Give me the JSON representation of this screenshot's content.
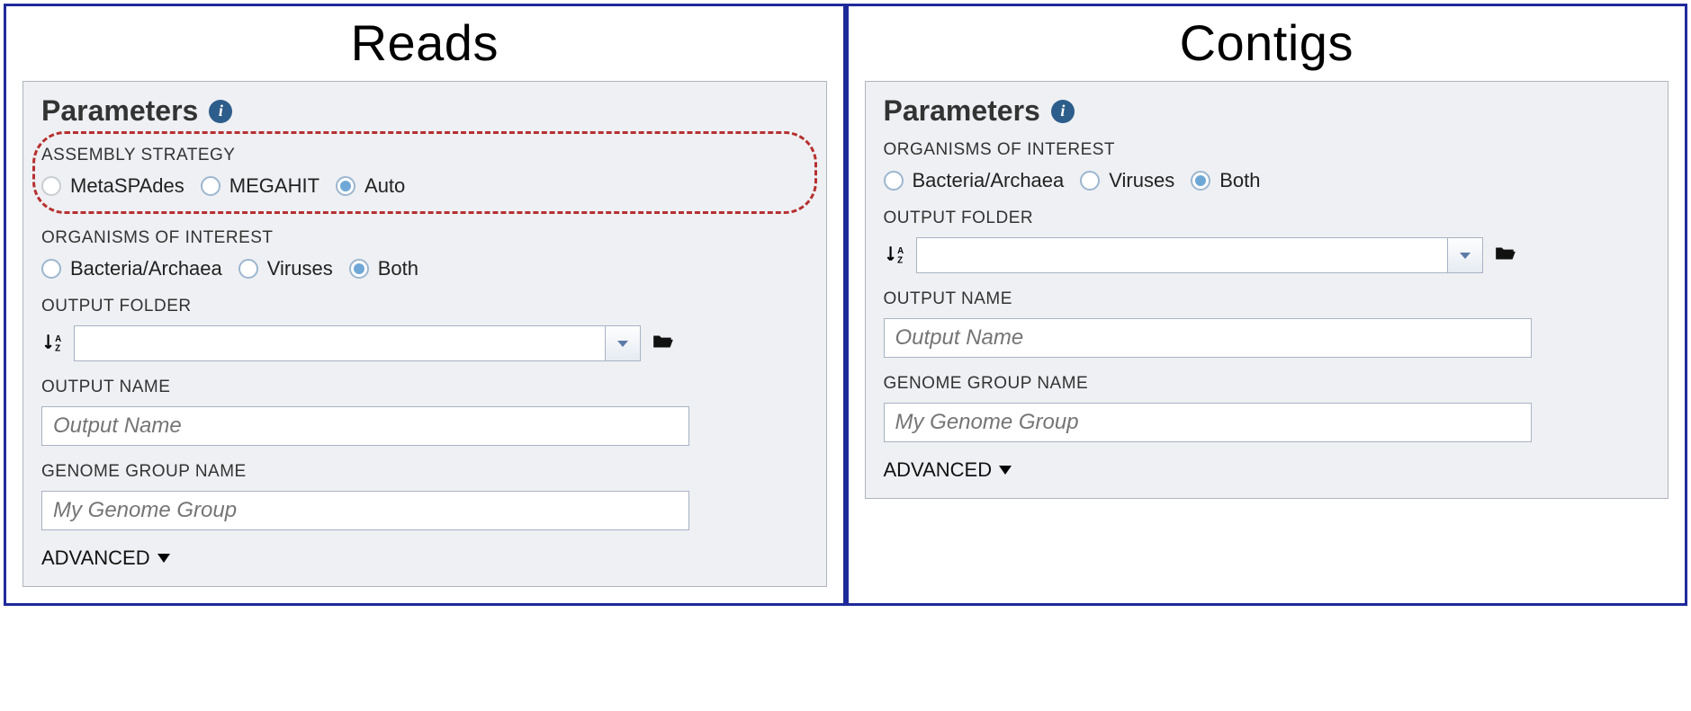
{
  "reads": {
    "title": "Reads",
    "params_heading": "Parameters",
    "assembly_strategy": {
      "label": "ASSEMBLY STRATEGY",
      "options": [
        "MetaSPAdes",
        "MEGAHIT",
        "Auto"
      ],
      "selected": "Auto"
    },
    "organisms": {
      "label": "ORGANISMS OF INTEREST",
      "options": [
        "Bacteria/Archaea",
        "Viruses",
        "Both"
      ],
      "selected": "Both"
    },
    "output_folder": {
      "label": "OUTPUT FOLDER",
      "value": ""
    },
    "output_name": {
      "label": "OUTPUT NAME",
      "value": "",
      "placeholder": "Output Name"
    },
    "genome_group": {
      "label": "GENOME GROUP NAME",
      "value": "",
      "placeholder": "My Genome Group"
    },
    "advanced_label": "ADVANCED"
  },
  "contigs": {
    "title": "Contigs",
    "params_heading": "Parameters",
    "organisms": {
      "label": "ORGANISMS OF INTEREST",
      "options": [
        "Bacteria/Archaea",
        "Viruses",
        "Both"
      ],
      "selected": "Both"
    },
    "output_folder": {
      "label": "OUTPUT FOLDER",
      "value": ""
    },
    "output_name": {
      "label": "OUTPUT NAME",
      "value": "",
      "placeholder": "Output Name"
    },
    "genome_group": {
      "label": "GENOME GROUP NAME",
      "value": "",
      "placeholder": "My Genome Group"
    },
    "advanced_label": "ADVANCED"
  }
}
